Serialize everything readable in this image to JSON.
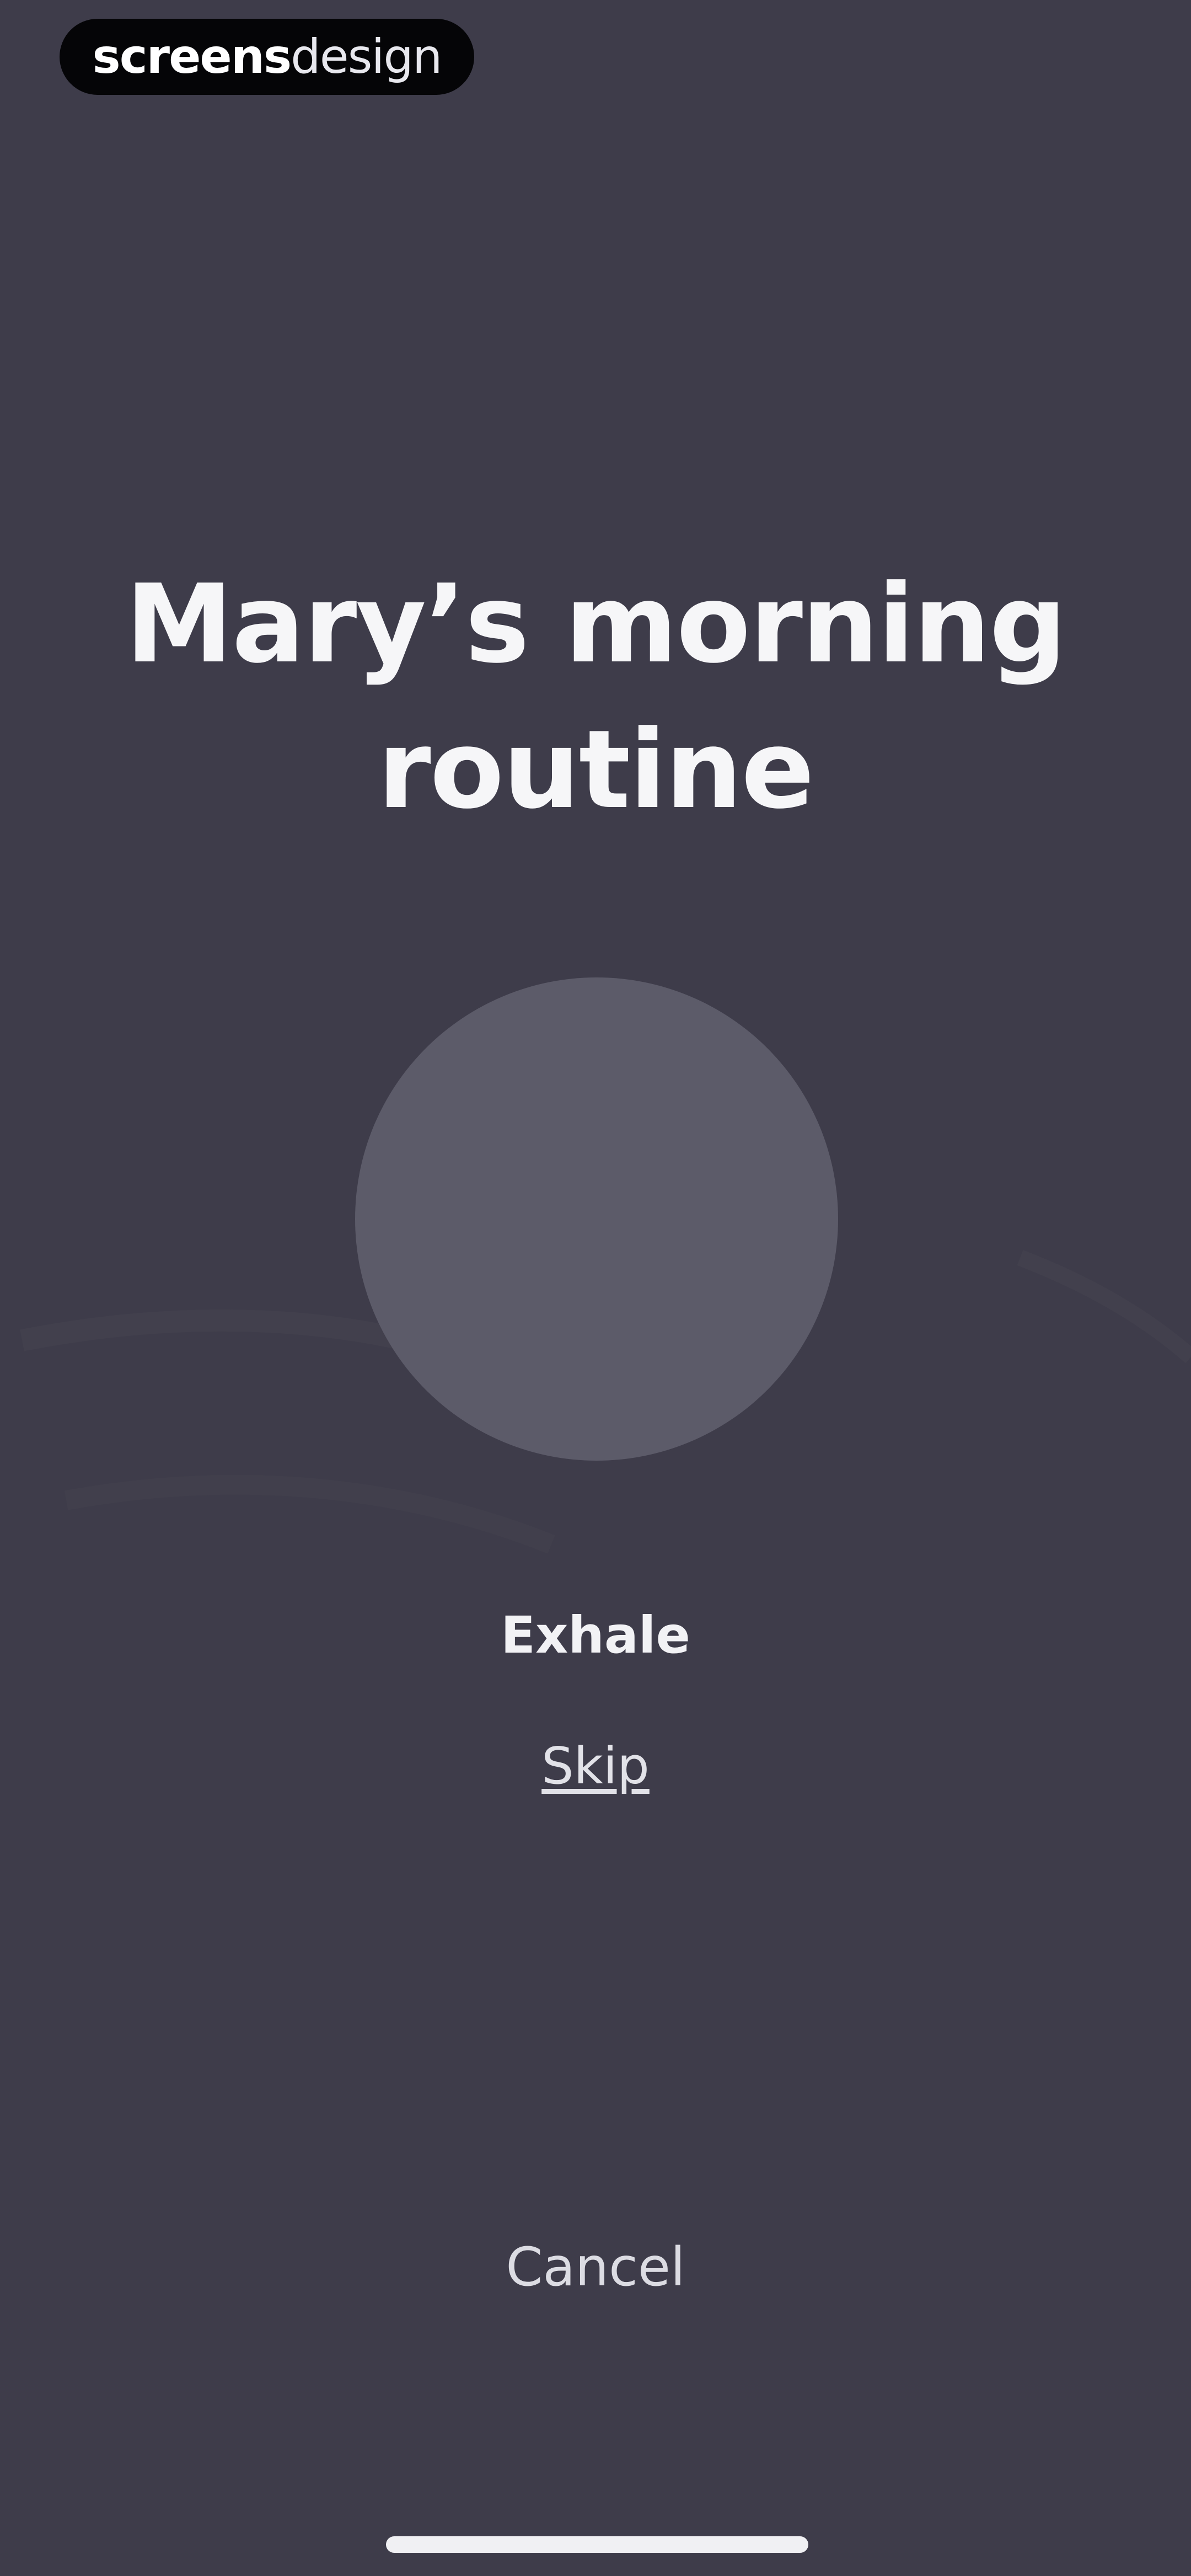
{
  "watermark": {
    "strong": "screens",
    "light": "design"
  },
  "session": {
    "title": "Mary’s morning routine",
    "phase": "Exhale"
  },
  "actions": {
    "skip_label": "Skip",
    "cancel_label": "Cancel"
  },
  "colors": {
    "background": "#3e3c4a",
    "circle": "#5c5b69",
    "text": "#f4f4f6"
  }
}
